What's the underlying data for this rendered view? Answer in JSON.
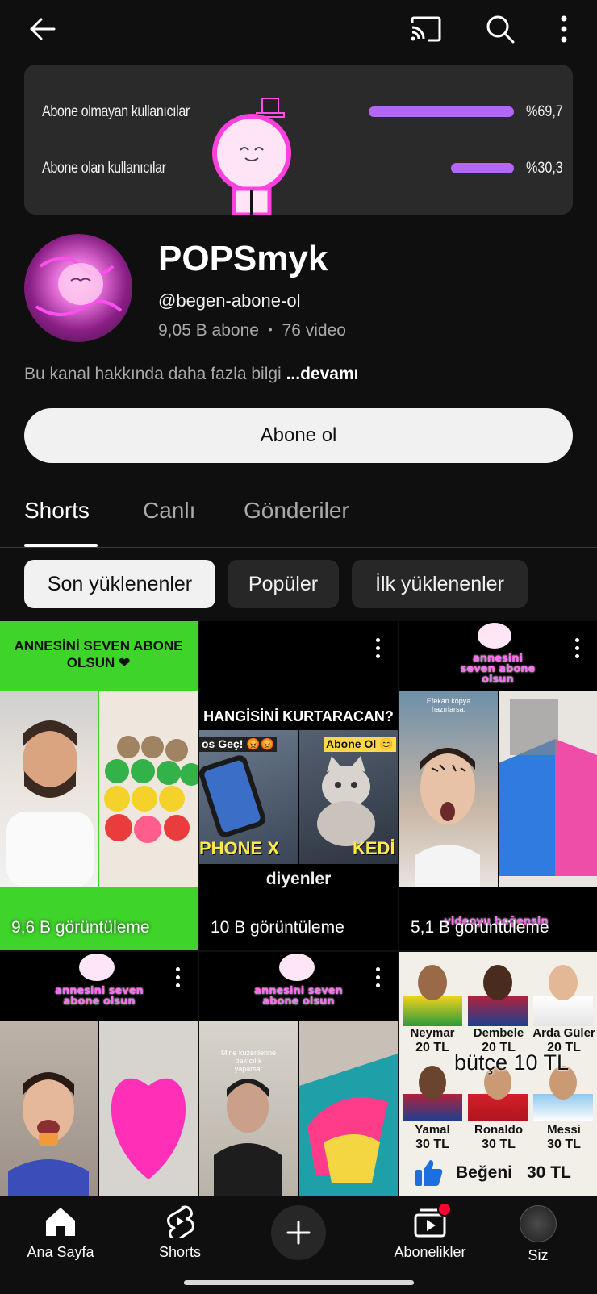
{
  "banner": {
    "rows": [
      {
        "label": "Abone olmayan kullanıcılar",
        "percent": "%69,7",
        "fraction": 0.697
      },
      {
        "label": "Abone olan kullanıcılar",
        "percent": "%30,3",
        "fraction": 0.303
      }
    ]
  },
  "channel": {
    "name": "POPSmyk",
    "handle": "@begen-abone-ol",
    "subscribers": "9,05 B abone",
    "separator": "•",
    "videos": "76 video",
    "about": "Bu kanal hakkında daha fazla bilgi",
    "more": "...devamı",
    "subscribe_label": "Abone ol"
  },
  "tabs": [
    {
      "label": "Shorts",
      "active": true
    },
    {
      "label": "Canlı",
      "active": false
    },
    {
      "label": "Gönderiler",
      "active": false
    }
  ],
  "chips": [
    {
      "label": "Son yüklenenler",
      "active": true
    },
    {
      "label": "Popüler",
      "active": false
    },
    {
      "label": "İlk yüklenenler",
      "active": false
    }
  ],
  "shorts": [
    {
      "views": "9,6 B görüntüleme",
      "header": "ANNESİNİ SEVEN ABONE OLSUN ❤"
    },
    {
      "views": "10 B görüntüleme",
      "header": "HANGİSİNİ KURTARACAN?",
      "left_top": "os Geç! 😡😡",
      "right_top": "Abone Ol 😊",
      "left_bottom": "PHONE X",
      "right_bottom": "KEDİ",
      "caption": "diyenler"
    },
    {
      "views": "5,1 B görüntüleme",
      "header": "annesini seven abone olsun",
      "overlay": "Efekan kopya hazırlarsa:",
      "footer": "videoyu beğensin"
    },
    {
      "header": "annesini seven abone olsun"
    },
    {
      "header": "annesini seven abone olsun",
      "overlay": "Mine kuzenlerine bakıcılık yaparsa:"
    },
    {
      "players": [
        {
          "name": "Neymar",
          "price": "20 TL"
        },
        {
          "name": "Dembele",
          "price": "20 TL"
        },
        {
          "name": "Arda Güler",
          "price": "20 TL"
        },
        {
          "name": "Yamal",
          "price": "30 TL"
        },
        {
          "name": "Ronaldo",
          "price": "30 TL"
        },
        {
          "name": "Messi",
          "price": "30 TL"
        }
      ],
      "budget": "bütçe 10 TL",
      "like_text": "Beğeni",
      "like_price": "30 TL"
    }
  ],
  "nav": [
    {
      "label": "Ana Sayfa",
      "icon": "home-icon"
    },
    {
      "label": "Shorts",
      "icon": "shorts-icon"
    },
    {
      "label": "",
      "icon": "create-icon"
    },
    {
      "label": "Abonelikler",
      "icon": "subscriptions-icon"
    },
    {
      "label": "Siz",
      "icon": "avatar"
    }
  ],
  "colors": {
    "background": "#0f0f0f",
    "bar": "#b268f5",
    "chip_active": "#f1f1f1",
    "chip_inactive": "#272727",
    "notification": "#ff0033"
  }
}
